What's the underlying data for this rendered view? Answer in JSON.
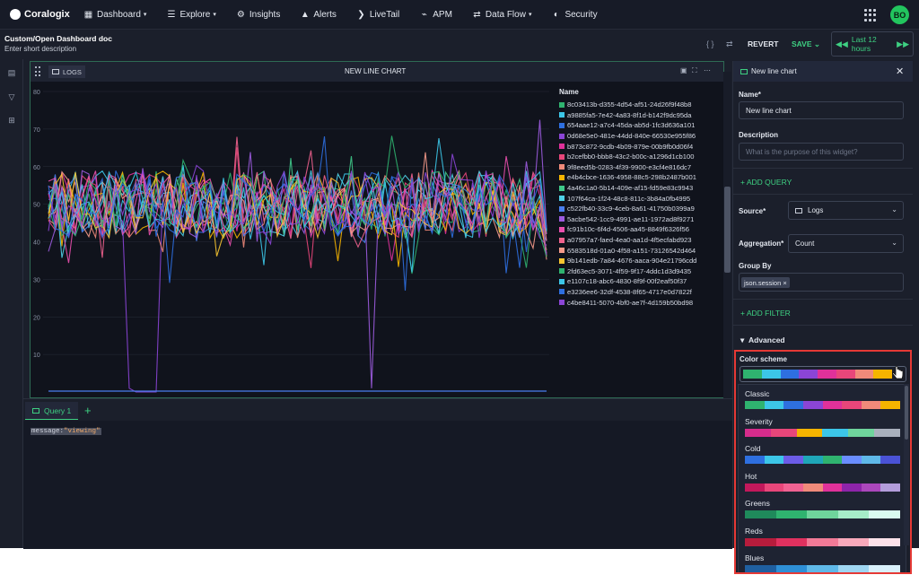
{
  "app": {
    "name": "Coralogix",
    "user_initials": "BO"
  },
  "nav": [
    {
      "label": "Dashboard",
      "icon": "dashboard-icon",
      "caret": true
    },
    {
      "label": "Explore",
      "icon": "explore-icon",
      "caret": true
    },
    {
      "label": "Insights",
      "icon": "insights-icon",
      "caret": false
    },
    {
      "label": "Alerts",
      "icon": "bell-icon",
      "caret": false
    },
    {
      "label": "LiveTail",
      "icon": "livetail-icon",
      "caret": false
    },
    {
      "label": "APM",
      "icon": "apm-icon",
      "caret": false
    },
    {
      "label": "Data Flow",
      "icon": "dataflow-icon",
      "caret": true
    },
    {
      "label": "Security",
      "icon": "shield-icon",
      "caret": false
    }
  ],
  "dashboard": {
    "title": "Custom/Open Dashboard doc",
    "description": "Enter short description"
  },
  "toolbar": {
    "code_icon": "{ }",
    "revert": "REVERT",
    "save": "SAVE",
    "time_range": "Last 12 hours"
  },
  "widget": {
    "source_tag": "LOGS",
    "title": "NEW LINE CHART"
  },
  "query": {
    "tab": "Query 1",
    "key": "message:",
    "value": "\"viewing\""
  },
  "settings": {
    "header": "New line chart",
    "name_label": "Name*",
    "name_value": "New line chart",
    "desc_label": "Description",
    "desc_placeholder": "What is the purpose of this widget?",
    "add_query": "ADD QUERY",
    "source_label": "Source*",
    "source_value": "Logs",
    "aggregation_label": "Aggregation*",
    "aggregation_value": "Count",
    "groupby_label": "Group By",
    "groupby_chip": "json.session ×",
    "add_filter": "ADD FILTER",
    "advanced": "Advanced",
    "color_scheme_label": "Color scheme"
  },
  "color_schemes": [
    {
      "name": "Classic",
      "colors": [
        "#2fb36f",
        "#3cc6e8",
        "#2e6fe0",
        "#8b45d6",
        "#e0319a",
        "#e8467a",
        "#f08a7a",
        "#f5b400"
      ]
    },
    {
      "name": "Severity",
      "colors": [
        "#d62c8c",
        "#e8467a",
        "#f5b400",
        "#3cc6e8",
        "#6fd49c",
        "#a9b0bd"
      ]
    },
    {
      "name": "Cold",
      "colors": [
        "#2e6fe0",
        "#3cc6e8",
        "#6c5ce7",
        "#1fa6b8",
        "#2fb36f",
        "#6a8dff",
        "#5fb8e8",
        "#4a52d6"
      ]
    },
    {
      "name": "Hot",
      "colors": [
        "#c2185b",
        "#e8467a",
        "#f06292",
        "#f08a7a",
        "#e0319a",
        "#8e24aa",
        "#ab47bc",
        "#b39ddb"
      ]
    },
    {
      "name": "Greens",
      "colors": [
        "#1f8a5b",
        "#2fb36f",
        "#6fd49c",
        "#a6ecc8",
        "#d9faf0"
      ]
    },
    {
      "name": "Reds",
      "colors": [
        "#b71c3c",
        "#e0315f",
        "#f27a97",
        "#f8a9bb",
        "#fde2ea"
      ]
    },
    {
      "name": "Blues",
      "colors": [
        "#1f5fa0",
        "#2e8fd6",
        "#5fb8e8",
        "#9fd6f2",
        "#d9f0fb"
      ]
    }
  ],
  "chart_data": {
    "type": "line",
    "legend_title": "Name",
    "ylim": [
      0,
      80
    ],
    "y_ticks": [
      "80",
      "70",
      "60",
      "50",
      "40",
      "30",
      "20",
      "10"
    ],
    "series": [
      {
        "name": "8c03413b-d355-4d54-af51-24d26f9f48b8",
        "color": "#2fb36f"
      },
      {
        "name": "a9885fa5-7e42-4a83-8f1d-b142f9dc95da",
        "color": "#3cc6e8"
      },
      {
        "name": "654aae12-a7c4-45da-ab5d-1fc3d636a101",
        "color": "#2e6fe0"
      },
      {
        "name": "0d68e5e0-481e-44dd-840e-66530e955f86",
        "color": "#8b45d6"
      },
      {
        "name": "b873c872-9cdb-4b09-879e-00b9fb0d06f4",
        "color": "#e0319a"
      },
      {
        "name": "b2cefbb0-bbb8-43c2-b00c-a1296d1cb100",
        "color": "#e8467a"
      },
      {
        "name": "9f8eed5b-0283-4f39-9900-e3cf4e816dc7",
        "color": "#f08a7a"
      },
      {
        "name": "e4b4cbce-1636-4958-88c5-298b2487b001",
        "color": "#f5b400"
      },
      {
        "name": "4a46c1a0-5b14-409e-af15-fd59e83c9943",
        "color": "#3fc98a"
      },
      {
        "name": "107f64ca-1f24-48c8-811c-3b84a0fb4995",
        "color": "#4fd1e8"
      },
      {
        "name": "c522fb40-33c9-4ceb-8a61-41750b0399a9",
        "color": "#4a7ff0"
      },
      {
        "name": "5acbe542-1cc9-4991-ae11-1972ad8f9271",
        "color": "#9d5ce0"
      },
      {
        "name": "fc91b10c-6f4d-4506-aa45-8849f6326f56",
        "color": "#ea4fae"
      },
      {
        "name": "a07957a7-faed-4ea0-aa1d-4f5ecfabd923",
        "color": "#f0628e"
      },
      {
        "name": "6583518d-01a0-4f58-a151-73126542d464",
        "color": "#f59a8a"
      },
      {
        "name": "9b141edb-7a84-4676-aaca-904e21796cdd",
        "color": "#f7c530"
      },
      {
        "name": "2fd63ec5-3071-4f59-9f17-4ddc1d3d9435",
        "color": "#2fb36f"
      },
      {
        "name": "e1107c18-abc6-4830-8f9f-00f2eaf50f37",
        "color": "#3cc6e8"
      },
      {
        "name": "e3236ee6-32df-4538-8f65-4717e0d7822f",
        "color": "#2e6fe0"
      },
      {
        "name": "c4be8411-5070-4bf0-ae7f-4d159b50bd98",
        "color": "#8b45d6"
      }
    ]
  }
}
